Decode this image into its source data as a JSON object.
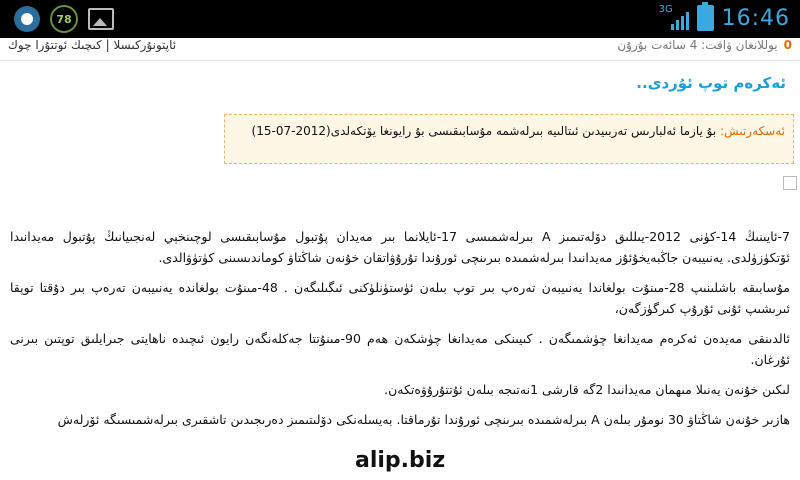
{
  "status_bar": {
    "badge": "78",
    "network": "3G",
    "time": "16:46",
    "icons": [
      "app-circle-icon",
      "gallery-icon",
      "signal-icon",
      "battery-icon"
    ]
  },
  "info_bar": {
    "count": "0",
    "text": "يوللانغان ۋاقت: 4 سائەت بۇرۇن",
    "right_link": "ئاپتونۇركىسلا | كىچىك ئوتتۇرا چوك"
  },
  "title": "ئەكرەم توپ ئۇردى..",
  "notice": {
    "label": "ئەسكەرتىش:",
    "text": "بۇ يازما ئەلبارىس تەربىيدىن ئىتالىيە بىرلەشمە مۇسابىقىسى بۇ رايونغا يۆتكەلدى(2012-07-15)"
  },
  "article": {
    "paragraphs": [
      "7-ئايىنىڭ 14-كۈنى 2012-يىللىق دۆلەتىمىز A بىرلەشمىسى 17-ئايلانما بىر مەيدان پۇتبول مۇسابىقىسى لوچىنخېي لەنجىيانىڭ پۇتبول مەيدانىدا ئۆتكۈزۈلدى. يەنىيبەن جاڭبەيخۇئۇز مەيدانىدا بىرلەشمىدە بىرىنچى ئورۇندا تۇرۇۋاتقان خۇنەن شاڭتاۋ كوماندىسىنى كۈتۈۋالدى.",
      "مۇسابىقە باشلىنىپ 28-مىنۇت بولغاندا يەنىيبەن تەرەپ بىر توپ بىلەن ئۈستۈنلۈكنى ئىگىلىگەن . 48-مىنۇت بولغاندە يەنىيبەن تەرەپ بىر دۇقتا توپقا ئىرىشىپ ئۇنى ئۇرۇپ كىرگۈزگەن،",
      "ئالدىنقى مەيدەن ئەكرەم مەيدانغا چۈشمىگەن . كىيىنكى مەيدانغا چۈشكەن ھەم 90-مىنۇتتا جەكلەنگەن رايون ئىچىدە ناھايتى جىرايلىق توپتىن بىرنى ئۇرغان.",
      "لىكىن خۇنەن يەنىلا مىھمان مەيدانىدا 2گە قارشى 1نەتىجە بىلەن ئۇتتۇرۇۋەتكەن.",
      "ھازىر خۇنەن شاڭتاۋ 30 نومۇر بىلەن A بىرلەشمىدە بىرىنچى ئورۇندا تۇرماقتا. بەيسلەنكى دۆلىتىمىز دەرىجىدىن تاشقىرى بىرلەشمىسىگە ئۆرلەش"
    ]
  },
  "watermark": "alip.biz"
}
